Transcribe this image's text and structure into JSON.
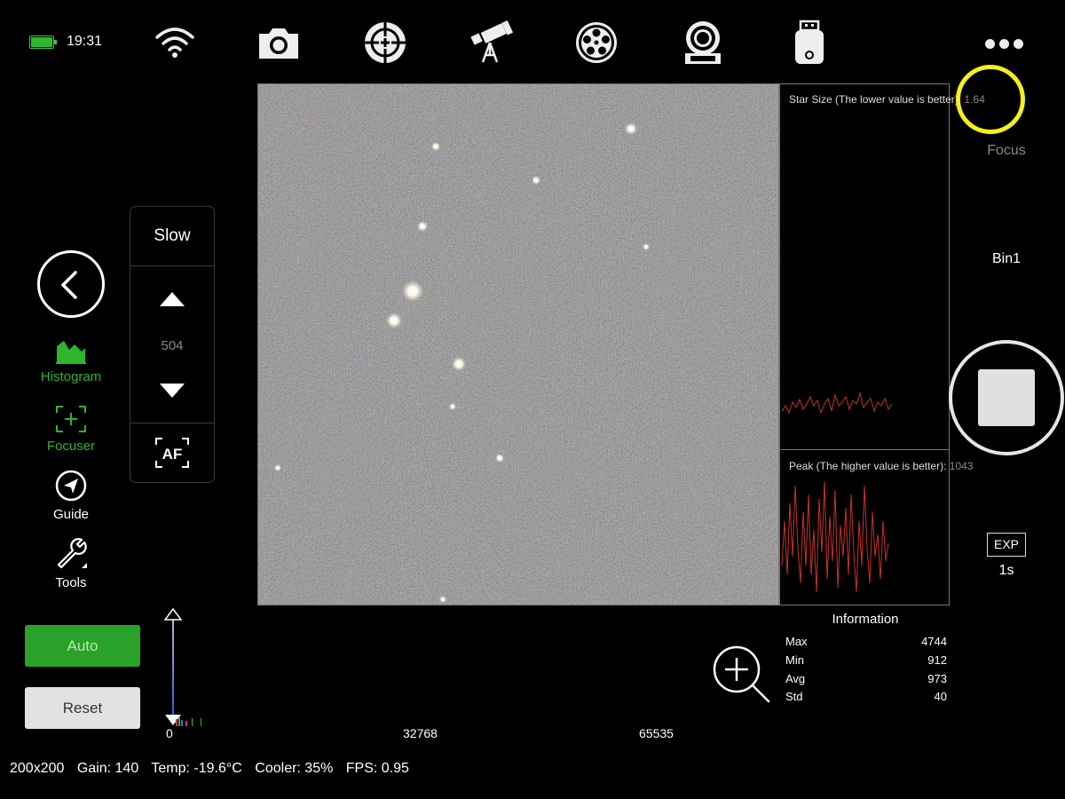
{
  "status_bar": {
    "time": "19:31"
  },
  "toolbar": {
    "icons": [
      "wifi-icon",
      "camera-icon",
      "crosshair-icon",
      "telescope-icon",
      "filter-wheel-icon",
      "camera-cooler-icon",
      "usb-drive-icon",
      "more-icon"
    ]
  },
  "left_tools": {
    "histogram": "Histogram",
    "focuser": "Focuser",
    "guide": "Guide",
    "tools": "Tools"
  },
  "focuser_panel": {
    "speed": "Slow",
    "position": "504",
    "af_label": "AF"
  },
  "buttons": {
    "auto": "Auto",
    "reset": "Reset"
  },
  "histogram_axis": {
    "min": "0",
    "mid": "32768",
    "max": "65535"
  },
  "star_size": {
    "label": "Star Size (The lower value is better): ",
    "value": "1.64"
  },
  "peak": {
    "label": "Peak (The higher value is better): ",
    "value": "1043"
  },
  "information": {
    "title": "Information",
    "rows": [
      {
        "label": "Max",
        "value": "4744"
      },
      {
        "label": "Min",
        "value": "912"
      },
      {
        "label": "Avg",
        "value": "973"
      },
      {
        "label": "Std",
        "value": "40"
      }
    ]
  },
  "right_panel": {
    "focus": "Focus",
    "bin": "Bin1",
    "exp_label": "EXP",
    "exp_value": "1s"
  },
  "bottom_status": {
    "resolution": "200x200",
    "gain": "Gain: 140",
    "temp": "Temp: -19.6°C",
    "cooler": "Cooler: 35%",
    "fps": "FPS: 0.95"
  },
  "colors": {
    "accent_green": "#2db52d",
    "highlight_yellow": "#f6f01a",
    "plot_red": "#c8322a"
  }
}
